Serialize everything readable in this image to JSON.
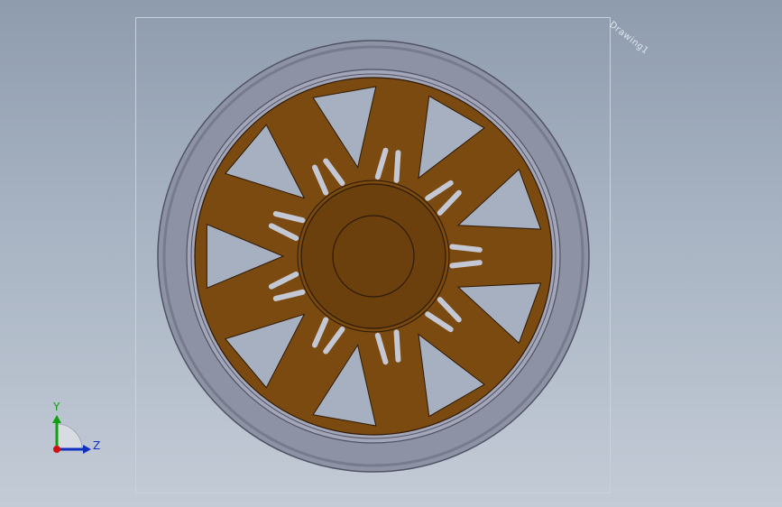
{
  "viewport": {
    "sheet_label": "Drawing1"
  },
  "triad": {
    "y_label": "Y",
    "z_label": "Z"
  },
  "colors": {
    "background_top": "#8f9cae",
    "background_bottom": "#c3cbd6",
    "tire": "#8f93a6",
    "tire_edge": "#5b5f70",
    "wheel_body": "#7a4a10",
    "hub": "#6a3f0c",
    "spoke_tips": "#b9bccb",
    "axis_y": "#10a010",
    "axis_z": "#1030c0",
    "axis_x": "#d01010"
  },
  "model": {
    "spoke_count": 9
  }
}
